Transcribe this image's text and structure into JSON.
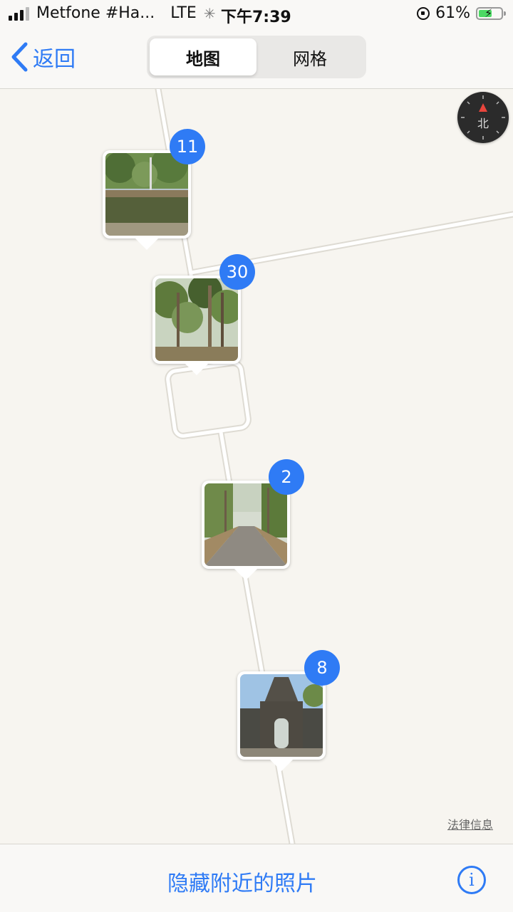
{
  "status": {
    "carrier": "Metfone #Ha...",
    "network": "LTE",
    "time": "下午7:39",
    "battery_text": "61%",
    "battery_level": 0.61
  },
  "nav": {
    "back_label": "返回",
    "segments": [
      "地图",
      "网格"
    ],
    "active_segment": "地图"
  },
  "map": {
    "compass_label": "北",
    "legal_label": "法律信息",
    "pins": [
      {
        "count": "11",
        "scene": "pond"
      },
      {
        "count": "30",
        "scene": "forest"
      },
      {
        "count": "2",
        "scene": "road"
      },
      {
        "count": "8",
        "scene": "gate"
      }
    ]
  },
  "toolbar": {
    "hide_label": "隐藏附近的照片",
    "info_icon": "i"
  }
}
